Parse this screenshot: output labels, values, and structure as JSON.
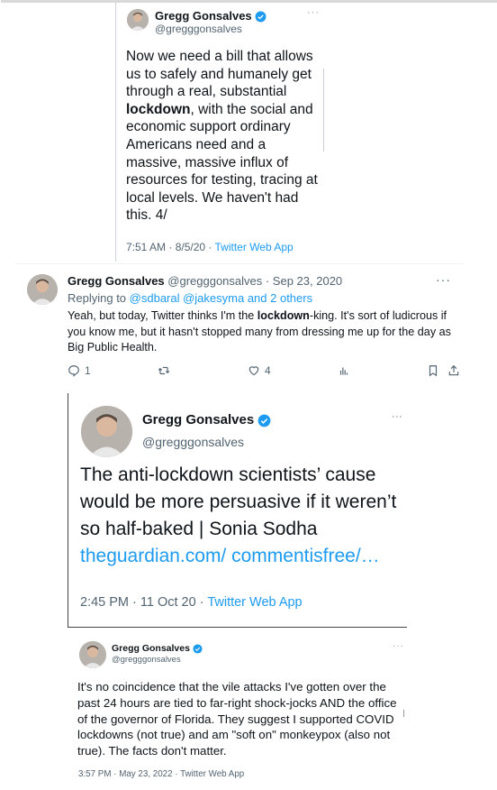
{
  "tweet1": {
    "name": "Gregg Gonsalves",
    "handle": "@gregggonsalves",
    "more": "···",
    "text_before": "Now we need a bill that allows us to safely and humanely get through a real, substantial ",
    "text_bold": "lockdown",
    "text_after": ", with the social and economic support ordinary Americans need and a massive, massive influx of resources for testing, tracing at local levels. We haven't had this. 4/",
    "time": "7:51 AM · 8/5/20 · ",
    "source": "Twitter Web App"
  },
  "tweet2": {
    "name": "Gregg Gonsalves",
    "handle_date": " @gregggonsalves · Sep 23, 2020",
    "more": "···",
    "replying_label": "Replying to ",
    "replying_to": "@sdbaral @jakesyma and 2 others",
    "text_before": "Yeah, but today, Twitter thinks I'm the ",
    "text_bold": "lockdown",
    "text_after": "-king. It's sort of ludicrous if you know me, but it hasn't stopped many from dressing me up for the day as Big Public Health.",
    "replies": "1",
    "likes": "4"
  },
  "tweet3": {
    "name": "Gregg Gonsalves",
    "handle": "@gregggonsalves",
    "more": "⋮",
    "text": "The anti-lockdown scientists’ cause would be more persuasive if it weren’t so half-baked | Sonia Sodha ",
    "link": "theguardian.com/ commentisfree/…",
    "time": "2:45 PM · 11 Oct 20 · ",
    "source": "Twitter Web App"
  },
  "tweet4": {
    "name": "Gregg Gonsalves",
    "handle": "@gregggonsalves",
    "more": "···",
    "text": "It's no coincidence that the vile attacks I've gotten over the past 24 hours are tied to far-right shock-jocks AND the office of the governor of Florida. They suggest I supported COVID lockdowns (not true) and am \"soft on\" monkeypox (also not true). The facts don't matter.",
    "time": "3:57 PM · May 23, 2022 · Twitter Web App"
  },
  "icons": {
    "verified": "verified-badge-icon",
    "reply": "reply-icon",
    "retweet": "retweet-icon",
    "like": "like-icon",
    "analytics": "analytics-icon",
    "bookmark": "bookmark-icon",
    "share": "share-icon"
  },
  "colors": {
    "link": "#1d9bf0",
    "verified": "#1d9bf0",
    "muted": "#536471"
  }
}
